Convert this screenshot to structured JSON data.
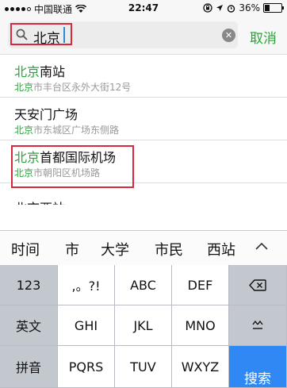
{
  "status_bar": {
    "carrier": "中国联通",
    "time": "22:47",
    "battery_label": "36%",
    "battery_level": 0.36,
    "icons": [
      "signal-dots-icon",
      "wifi-icon",
      "orientation-lock-icon",
      "location-icon",
      "alarm-icon",
      "battery-icon"
    ]
  },
  "search": {
    "query": "北京",
    "cancel_label": "取消"
  },
  "results": [
    {
      "highlight": "北京",
      "title_rest": "南站",
      "sub_highlight": "北京",
      "sub_rest": "市丰台区永外大街12号"
    },
    {
      "highlight": "",
      "title_rest": "天安门广场",
      "sub_highlight": "北京",
      "sub_rest": "市东城区广场东侧路"
    },
    {
      "highlight": "北京",
      "title_rest": "首都国际机场",
      "sub_highlight": "北京",
      "sub_rest": "市朝阳区机场路"
    }
  ],
  "partial_result": "北京西站",
  "suggestions": [
    "时间",
    "市",
    "大学",
    "市民",
    "西站"
  ],
  "keyboard": {
    "row1": [
      "123",
      ",。?!",
      "ABC",
      "DEF"
    ],
    "row2": [
      "英文",
      "GHI",
      "JKL",
      "MNO"
    ],
    "row3": [
      "拼音",
      "PQRS",
      "TUV",
      "WXYZ"
    ],
    "search_label": "搜索",
    "delete_icon": "backspace-icon",
    "shift_icon": "caret-shift-icon"
  },
  "colors": {
    "accent_green": "#2aa43a",
    "annotation_red": "#d8283a",
    "search_key_blue": "#2f88f4"
  }
}
